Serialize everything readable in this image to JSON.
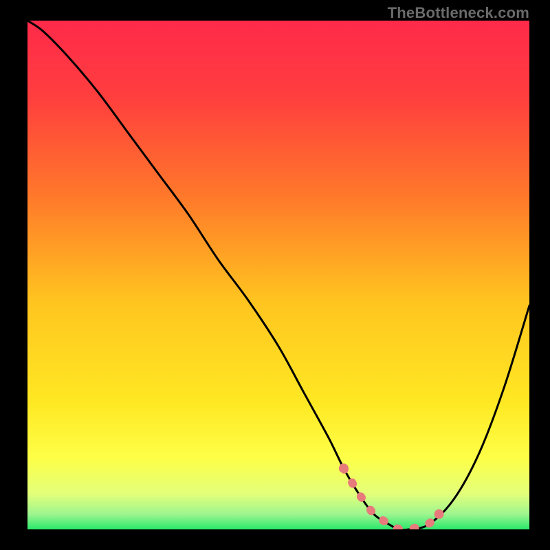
{
  "watermark": "TheBottleneck.com",
  "colors": {
    "background": "#000000",
    "gradient_stops": [
      {
        "offset": 0.0,
        "color": "#ff2a4a"
      },
      {
        "offset": 0.15,
        "color": "#ff3e3e"
      },
      {
        "offset": 0.35,
        "color": "#ff7a2a"
      },
      {
        "offset": 0.55,
        "color": "#ffc41f"
      },
      {
        "offset": 0.75,
        "color": "#ffe823"
      },
      {
        "offset": 0.86,
        "color": "#fdff47"
      },
      {
        "offset": 0.93,
        "color": "#e3ff7a"
      },
      {
        "offset": 0.97,
        "color": "#9ef58f"
      },
      {
        "offset": 1.0,
        "color": "#29e96b"
      }
    ],
    "curve": "#000000",
    "highlight": "#e77b7b",
    "watermark": "#6a6a6a"
  },
  "chart_data": {
    "type": "line",
    "title": "",
    "xlabel": "",
    "ylabel": "",
    "xlim": [
      0,
      100
    ],
    "ylim": [
      0,
      100
    ],
    "grid": false,
    "legend": null,
    "annotations": [],
    "series": [
      {
        "name": "bottleneck-curve",
        "x": [
          0,
          3,
          8,
          14,
          20,
          26,
          32,
          38,
          44,
          50,
          55,
          60,
          63,
          66,
          69,
          72,
          74,
          76,
          80,
          85,
          90,
          95,
          100
        ],
        "values": [
          100,
          98,
          93,
          86,
          78,
          70,
          62,
          53,
          45,
          36,
          27,
          18,
          12,
          7,
          3,
          1,
          0,
          0,
          1,
          6,
          15,
          28,
          44
        ]
      }
    ],
    "highlight_segment": {
      "series": "bottleneck-curve",
      "x_start": 63,
      "x_end": 82,
      "style": "thick-pink-dotted"
    }
  }
}
